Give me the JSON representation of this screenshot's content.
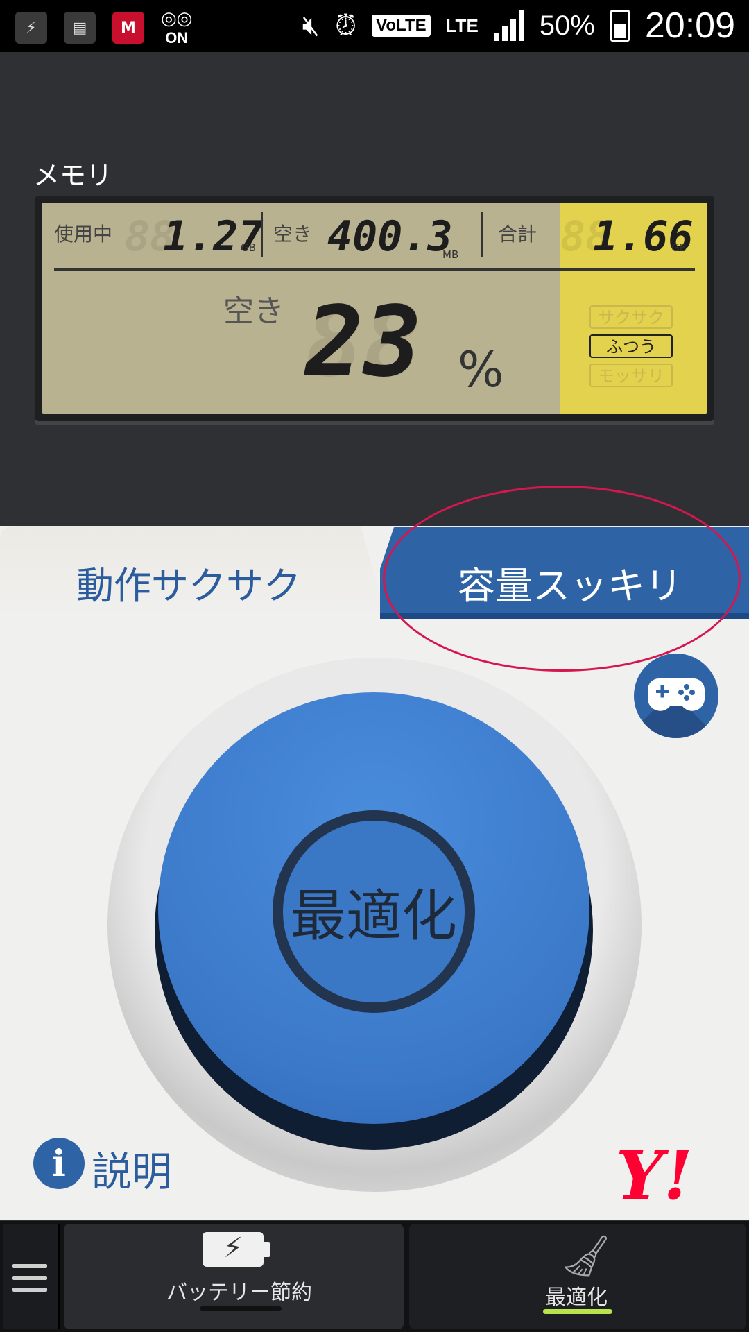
{
  "status_bar": {
    "battery_percent": "50%",
    "time": "20:09",
    "network": "LTE",
    "volte": "VoLTE",
    "voicemail_on": "ON",
    "icons": [
      "battery-charge-app-icon",
      "sd-card-icon",
      "mcafee-icon",
      "voicemail-icon",
      "mute-icon",
      "alarm-icon",
      "volte-icon",
      "lte-icon",
      "signal-icon",
      "battery-icon"
    ]
  },
  "memory": {
    "title": "メモリ",
    "used_label": "使用中",
    "used_value": "1.27",
    "used_unit": "GB",
    "free_label": "空き",
    "free_value": "400.3",
    "free_unit": "MB",
    "total_label": "合計",
    "total_value": "1.66",
    "total_unit": "GB",
    "free_pct_label": "空き",
    "free_pct_value": "23",
    "free_pct_unit": "%",
    "status_options": [
      "サクサク",
      "ふつう",
      "モッサリ"
    ],
    "status_active": "ふつう"
  },
  "tabs": {
    "left": "動作サクサク",
    "right": "容量スッキリ"
  },
  "optimize_button": {
    "label": "最適化"
  },
  "info": {
    "label": "説明"
  },
  "brand": {
    "logo": "Y!"
  },
  "bottom_nav": {
    "left_label": "バッテリー節約",
    "right_label": "最適化"
  },
  "colors": {
    "accent": "#2e63a6",
    "button_blue": "#3b78c8",
    "lcd_bg": "#b9b290",
    "lcd_highlight": "#e2d24e",
    "annotation": "#d6174f",
    "active_indicator": "#b8e34b"
  }
}
